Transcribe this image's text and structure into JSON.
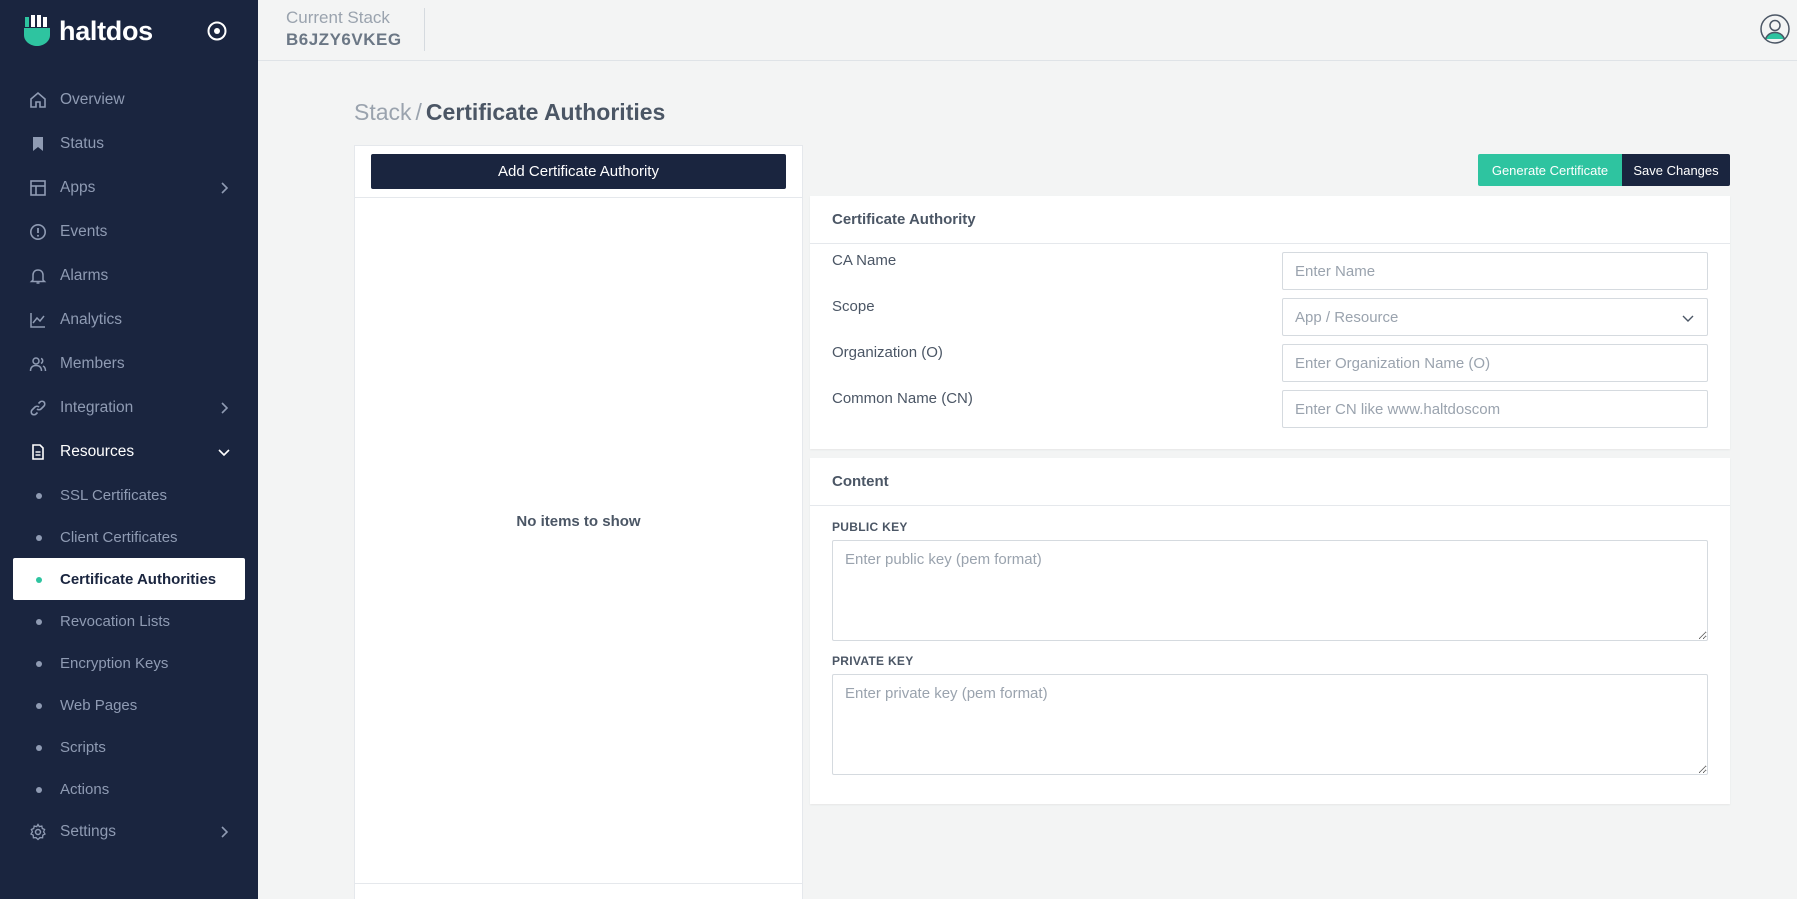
{
  "brand": {
    "name": "haltdos"
  },
  "topbar": {
    "stack_label": "Current Stack",
    "stack_value": "B6JZY6VKEG"
  },
  "nav": {
    "items": [
      {
        "label": "Overview",
        "icon": "home-icon"
      },
      {
        "label": "Status",
        "icon": "bookmark-icon"
      },
      {
        "label": "Apps",
        "icon": "layout-icon"
      },
      {
        "label": "Events",
        "icon": "alert-circle-icon"
      },
      {
        "label": "Alarms",
        "icon": "bell-icon"
      },
      {
        "label": "Analytics",
        "icon": "chart-line-icon"
      },
      {
        "label": "Members",
        "icon": "users-icon"
      },
      {
        "label": "Integration",
        "icon": "link-icon"
      },
      {
        "label": "Resources",
        "icon": "document-icon"
      },
      {
        "label": "Settings",
        "icon": "gear-icon"
      }
    ],
    "resources_sub": [
      "SSL Certificates",
      "Client Certificates",
      "Certificate Authorities",
      "Revocation Lists",
      "Encryption Keys",
      "Web Pages",
      "Scripts",
      "Actions"
    ]
  },
  "page": {
    "breadcrumb": "Stack",
    "separator": "/",
    "title": "Certificate Authorities"
  },
  "list": {
    "add_button": "Add Certificate Authority",
    "empty_text": "No items to show"
  },
  "actions": {
    "generate": "Generate Certificate",
    "save": "Save Changes"
  },
  "ca_form": {
    "header": "Certificate Authority",
    "name_label": "CA Name",
    "name_placeholder": "Enter Name",
    "scope_label": "Scope",
    "scope_placeholder": "App / Resource",
    "org_label": "Organization (O)",
    "org_placeholder": "Enter Organization Name (O)",
    "cn_label": "Common Name (CN)",
    "cn_placeholder": "Enter CN like www.haltdoscom"
  },
  "content": {
    "header": "Content",
    "public_label": "PUBLIC KEY",
    "public_placeholder": "Enter public key (pem format)",
    "private_label": "PRIVATE KEY",
    "private_placeholder": "Enter private key (pem format)"
  },
  "colors": {
    "sidebar": "#1a253f",
    "accent": "#2ec4a0",
    "background": "#f3f4f4"
  }
}
